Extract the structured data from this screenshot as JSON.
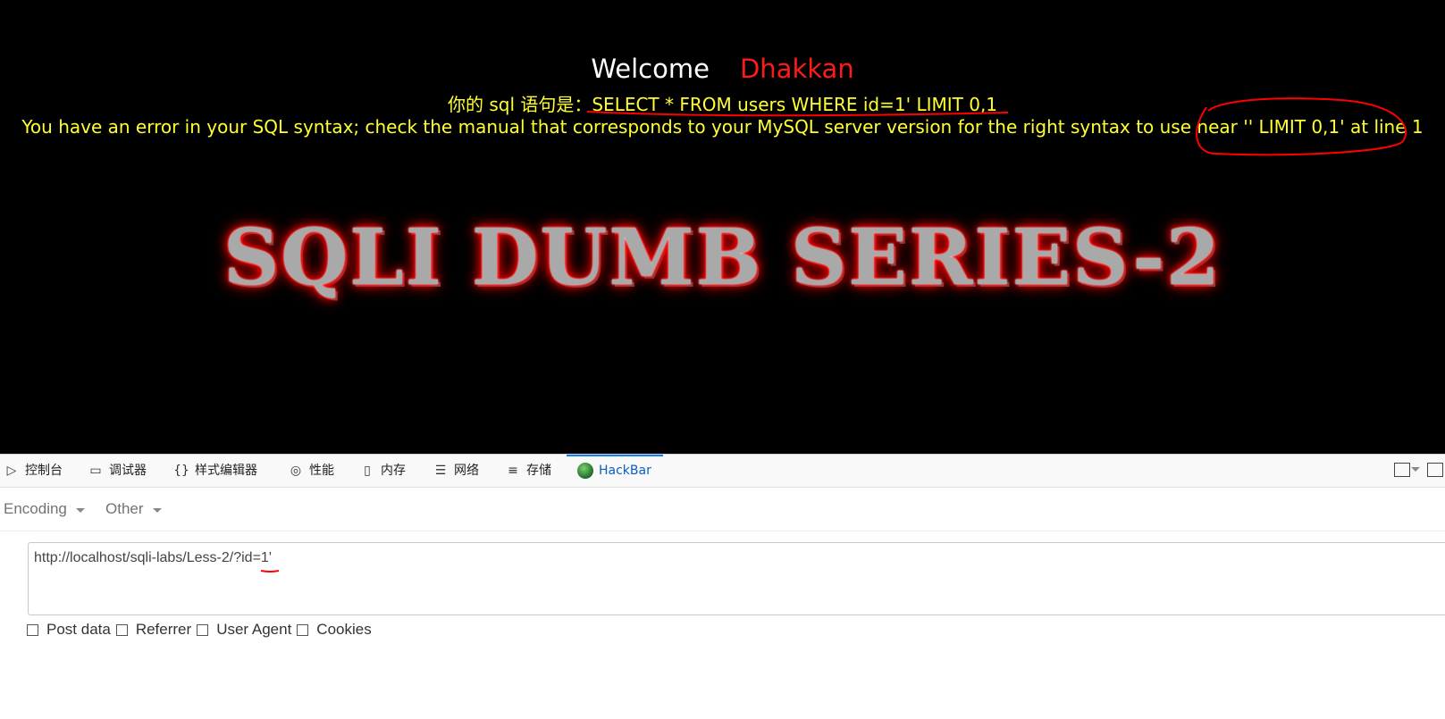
{
  "page": {
    "welcome_label": "Welcome",
    "username": "Dhakkan",
    "sql_prefix": "你的 sql 语句是：",
    "sql_query": "SELECT * FROM users WHERE id=1' LIMIT 0,1",
    "error_message": "You have an error in your SQL syntax; check the manual that corresponds to your MySQL server version for the right syntax to use near '' LIMIT 0,1' at line 1",
    "banner_title": "SQLI DUMB SERIES-2",
    "colors": {
      "background": "#000000",
      "welcome": "#ffffff",
      "username": "#ff1a1a",
      "message": "#ffff33",
      "annotation": "#ff0000"
    }
  },
  "devtools": {
    "tabs": [
      {
        "label": "控制台",
        "icon": "console-icon"
      },
      {
        "label": "调试器",
        "icon": "debugger-icon"
      },
      {
        "label": "样式编辑器",
        "icon": "braces-icon"
      },
      {
        "label": "性能",
        "icon": "performance-icon"
      },
      {
        "label": "内存",
        "icon": "memory-icon"
      },
      {
        "label": "网络",
        "icon": "network-icon"
      },
      {
        "label": "存储",
        "icon": "storage-icon"
      },
      {
        "label": "HackBar",
        "icon": "hackbar-icon",
        "active": true
      }
    ],
    "hackbar": {
      "encoding_label": "Encoding",
      "other_label": "Other",
      "url_prefix": "http://localhost/sqli-labs/Less-2/?id=",
      "url_suffix": "1'",
      "options": [
        "Post data",
        "Referrer",
        "User Agent",
        "Cookies"
      ]
    }
  }
}
